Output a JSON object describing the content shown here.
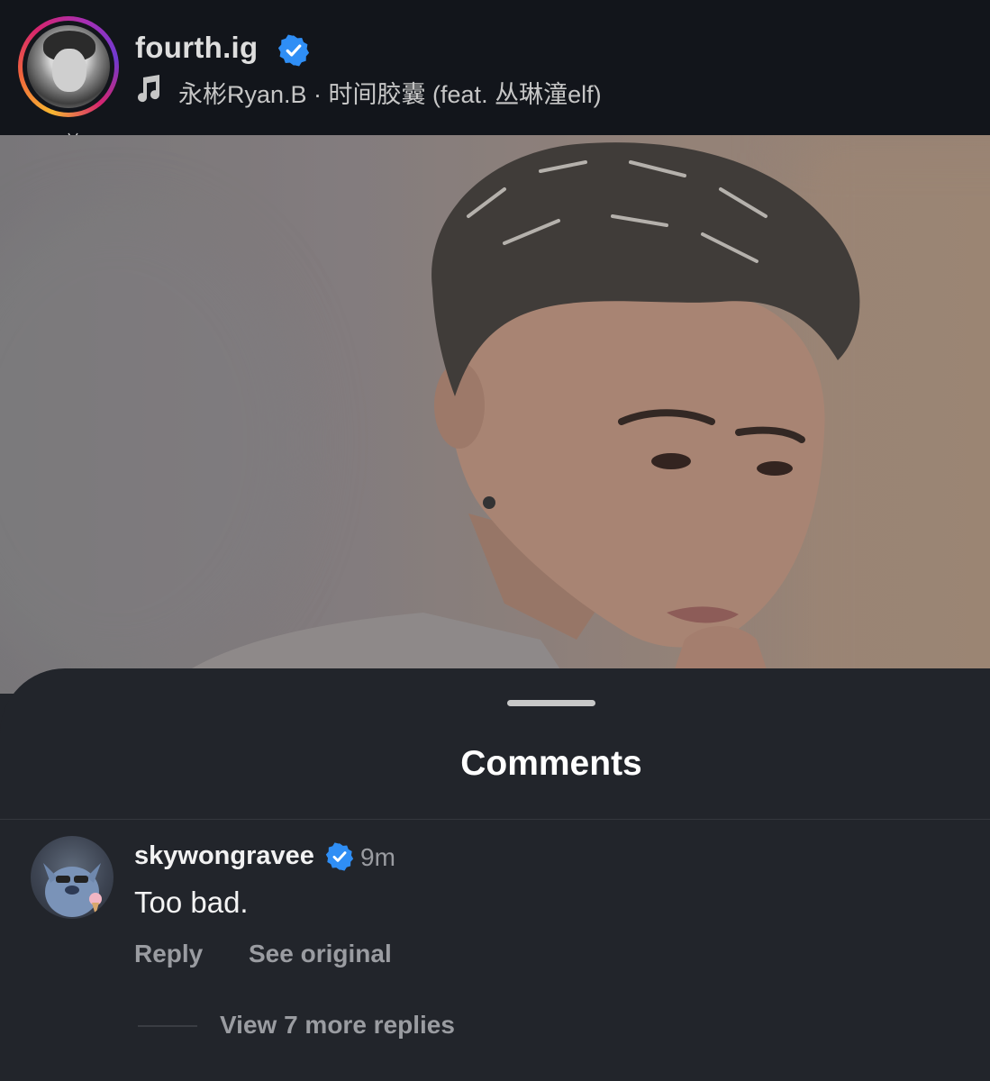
{
  "header": {
    "username": "fourth.ig",
    "music": "永彬Ryan.B · 时间胶囊 (feat. 丛琳潼elf)"
  },
  "comments_sheet": {
    "title": "Comments",
    "comment": {
      "username": "skywongravee",
      "time": "9m",
      "text": "Too bad.",
      "reply_label": "Reply",
      "see_original_label": "See original",
      "view_replies_label": "View 7 more replies"
    }
  },
  "colors": {
    "header_bg": "#12151b",
    "sheet_bg": "#22252b",
    "verified": "#2f8ef5",
    "muted_text": "#9a9ca1"
  },
  "icons": [
    "music-note-icon",
    "verified-badge-icon"
  ]
}
